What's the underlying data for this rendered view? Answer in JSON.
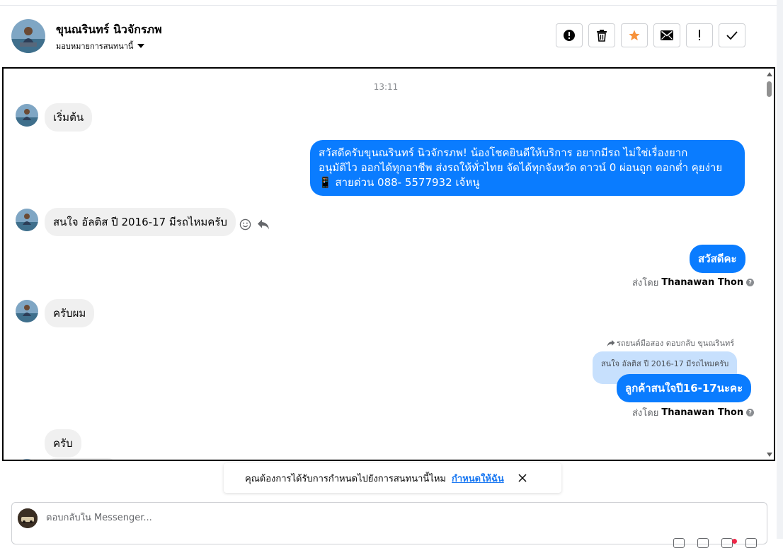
{
  "header": {
    "contact_name": "ขุนณรินทร์ นิวจักรภพ",
    "assign_label": "มอบหมายการสนทนานี้",
    "actions": [
      {
        "name": "spam",
        "icon": "alert-circle-icon"
      },
      {
        "name": "delete",
        "icon": "trash-icon"
      },
      {
        "name": "star",
        "icon": "star-icon",
        "color": "#f7923b"
      },
      {
        "name": "mark-unread",
        "icon": "envelope-icon"
      },
      {
        "name": "follow-up",
        "icon": "exclamation-icon"
      },
      {
        "name": "done",
        "icon": "checkmark-icon"
      }
    ]
  },
  "chat": {
    "timestamp": "13:11",
    "messages": [
      {
        "dir": "in",
        "text": "เริ่มต้น"
      },
      {
        "dir": "out",
        "lines": [
          "สวัสดีครับขุนณรินทร์ นิวจักรภพ! น้องโชคยินดีให้บริการ อยากมีรถ ไม่ใช่เรื่องยาก",
          "อนุมัติไว ออกได้ทุกอาชีพ ส่งรถให้ทั่วไทย จัดได้ทุกจังหวัด ดาวน์ 0  ผ่อนถูก ดอกต่ำ คุยง่าย",
          "สายด่วน 088- 5577932 เจ้หนู"
        ],
        "phone_icon": "📱"
      },
      {
        "dir": "in",
        "text": "สนใจ อัลติส ปี 2016-17 มีรถไหมครับ"
      },
      {
        "dir": "out",
        "text": "สวัสดีคะ"
      },
      {
        "dir": "in",
        "text": "ครับผม"
      },
      {
        "dir": "out",
        "text": "ลูกค้าสนใจปี16-17นะคะ",
        "reply_label": "รถยนต์มือสอง ตอบกลับ ขุนณรินทร์",
        "quoted": "สนใจ อัลติส ปี 2016-17 มีรถไหมครับ"
      },
      {
        "dir": "in",
        "text": "ครับ"
      }
    ],
    "sent_by_prefix": "ส่งโดย",
    "sent_by_name": "Thanawan Thon",
    "info_mark": "?"
  },
  "reminder": {
    "text": "คุณต้องการได้รับการกำหนดไปยังการสนทนานี้ไหม",
    "link": "กำหนดให้ฉัน"
  },
  "composer": {
    "placeholder": "ตอบกลับใน Messenger..."
  },
  "colors": {
    "outgoing_bubble": "#0a7cff",
    "incoming_bubble": "#f0f0f0",
    "link": "#1877f2",
    "star": "#f7923b"
  }
}
